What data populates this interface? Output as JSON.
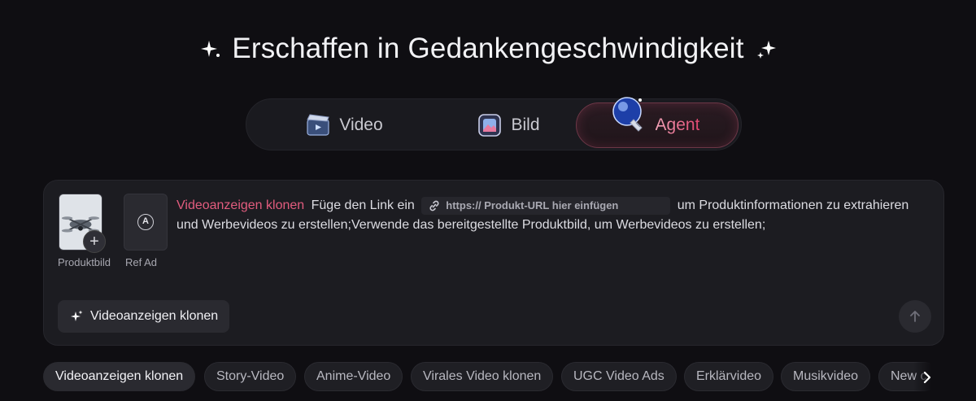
{
  "headline": {
    "text": "Erschaffen in Gedankengeschwindigkeit",
    "left_icon": "sparkle-icon",
    "right_icon": "sparkle-icon"
  },
  "mode_tabs": [
    {
      "label": "Video",
      "icon": "clapperboard-icon",
      "active": false
    },
    {
      "label": "Bild",
      "icon": "image-icon",
      "active": false
    },
    {
      "label": "Agent",
      "icon": "lightbulb-icon",
      "active": true
    }
  ],
  "prompt": {
    "thumbnails": [
      {
        "caption": "Produktbild",
        "icon": "drone-image"
      },
      {
        "caption": "Ref Ad",
        "icon": "ref-ad-icon"
      }
    ],
    "tag": "Videoanzeigen klonen",
    "text_before_link": "Füge den Link ein",
    "url_placeholder": "https:// Produkt-URL hier einfügen",
    "text_after_link": "um Produktinformationen zu extrahieren und Werbevideos zu erstellen;Verwende das bereitgestellte Produktbild, um Werbevideos zu erstellen;",
    "action_label": "Videoanzeigen klonen"
  },
  "suggestions": [
    {
      "label": "Videoanzeigen klonen",
      "active": true
    },
    {
      "label": "Story-Video",
      "active": false
    },
    {
      "label": "Anime-Video",
      "active": false
    },
    {
      "label": "Virales Video klonen",
      "active": false
    },
    {
      "label": "UGC Video Ads",
      "active": false
    },
    {
      "label": "Erklärvideo",
      "active": false
    },
    {
      "label": "Musikvideo",
      "active": false
    },
    {
      "label": "New c",
      "active": false
    }
  ],
  "colors": {
    "background": "#0f0e12",
    "accent": "#e25c7e",
    "card": "#1c1c21"
  }
}
